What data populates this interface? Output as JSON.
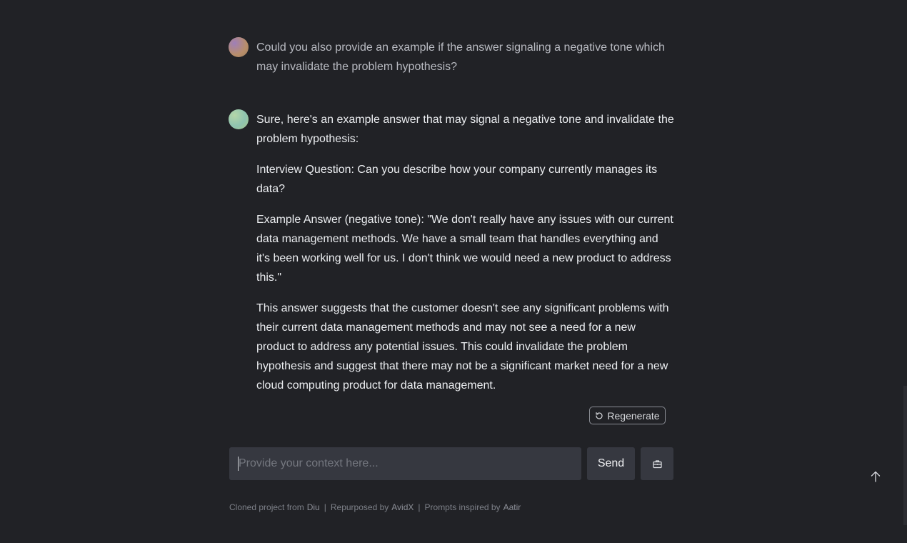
{
  "conversation": {
    "user_message": "Could you also provide an example if the answer signaling a negative tone which may invalidate the problem hypothesis?",
    "bot_message": {
      "paragraphs": [
        "Sure, here's an example answer that may signal a negative tone and invalidate the problem hypothesis:",
        "Interview Question: Can you describe how your company currently manages its data?",
        "Example Answer (negative tone): \"We don't really have any issues with our current data management methods. We have a small team that handles everything and it's been working well for us. I don't think we would need a new product to address this.\"",
        "This answer suggests that the customer doesn't see any significant problems with their current data management methods and may not see a need for a new product to address any potential issues. This could invalidate the problem hypothesis and suggest that there may not be a significant market need for a new cloud computing product for data management."
      ]
    }
  },
  "actions": {
    "regenerate_label": "Regenerate"
  },
  "composer": {
    "placeholder": "Provide your context here...",
    "value": "",
    "send_label": "Send"
  },
  "footer": {
    "cloned_text": "Cloned project from",
    "cloned_link": "Diu",
    "repurposed_text": "Repurposed by",
    "repurposed_link": "AvidX",
    "prompts_text": "Prompts inspired by",
    "prompts_link": "Aatir",
    "separator": "|"
  },
  "icons": {
    "regenerate": "refresh-icon",
    "tool": "briefcase-icon",
    "scroll_top": "arrow-up-icon"
  },
  "colors": {
    "background": "#212226",
    "input_bg": "#363840"
  }
}
